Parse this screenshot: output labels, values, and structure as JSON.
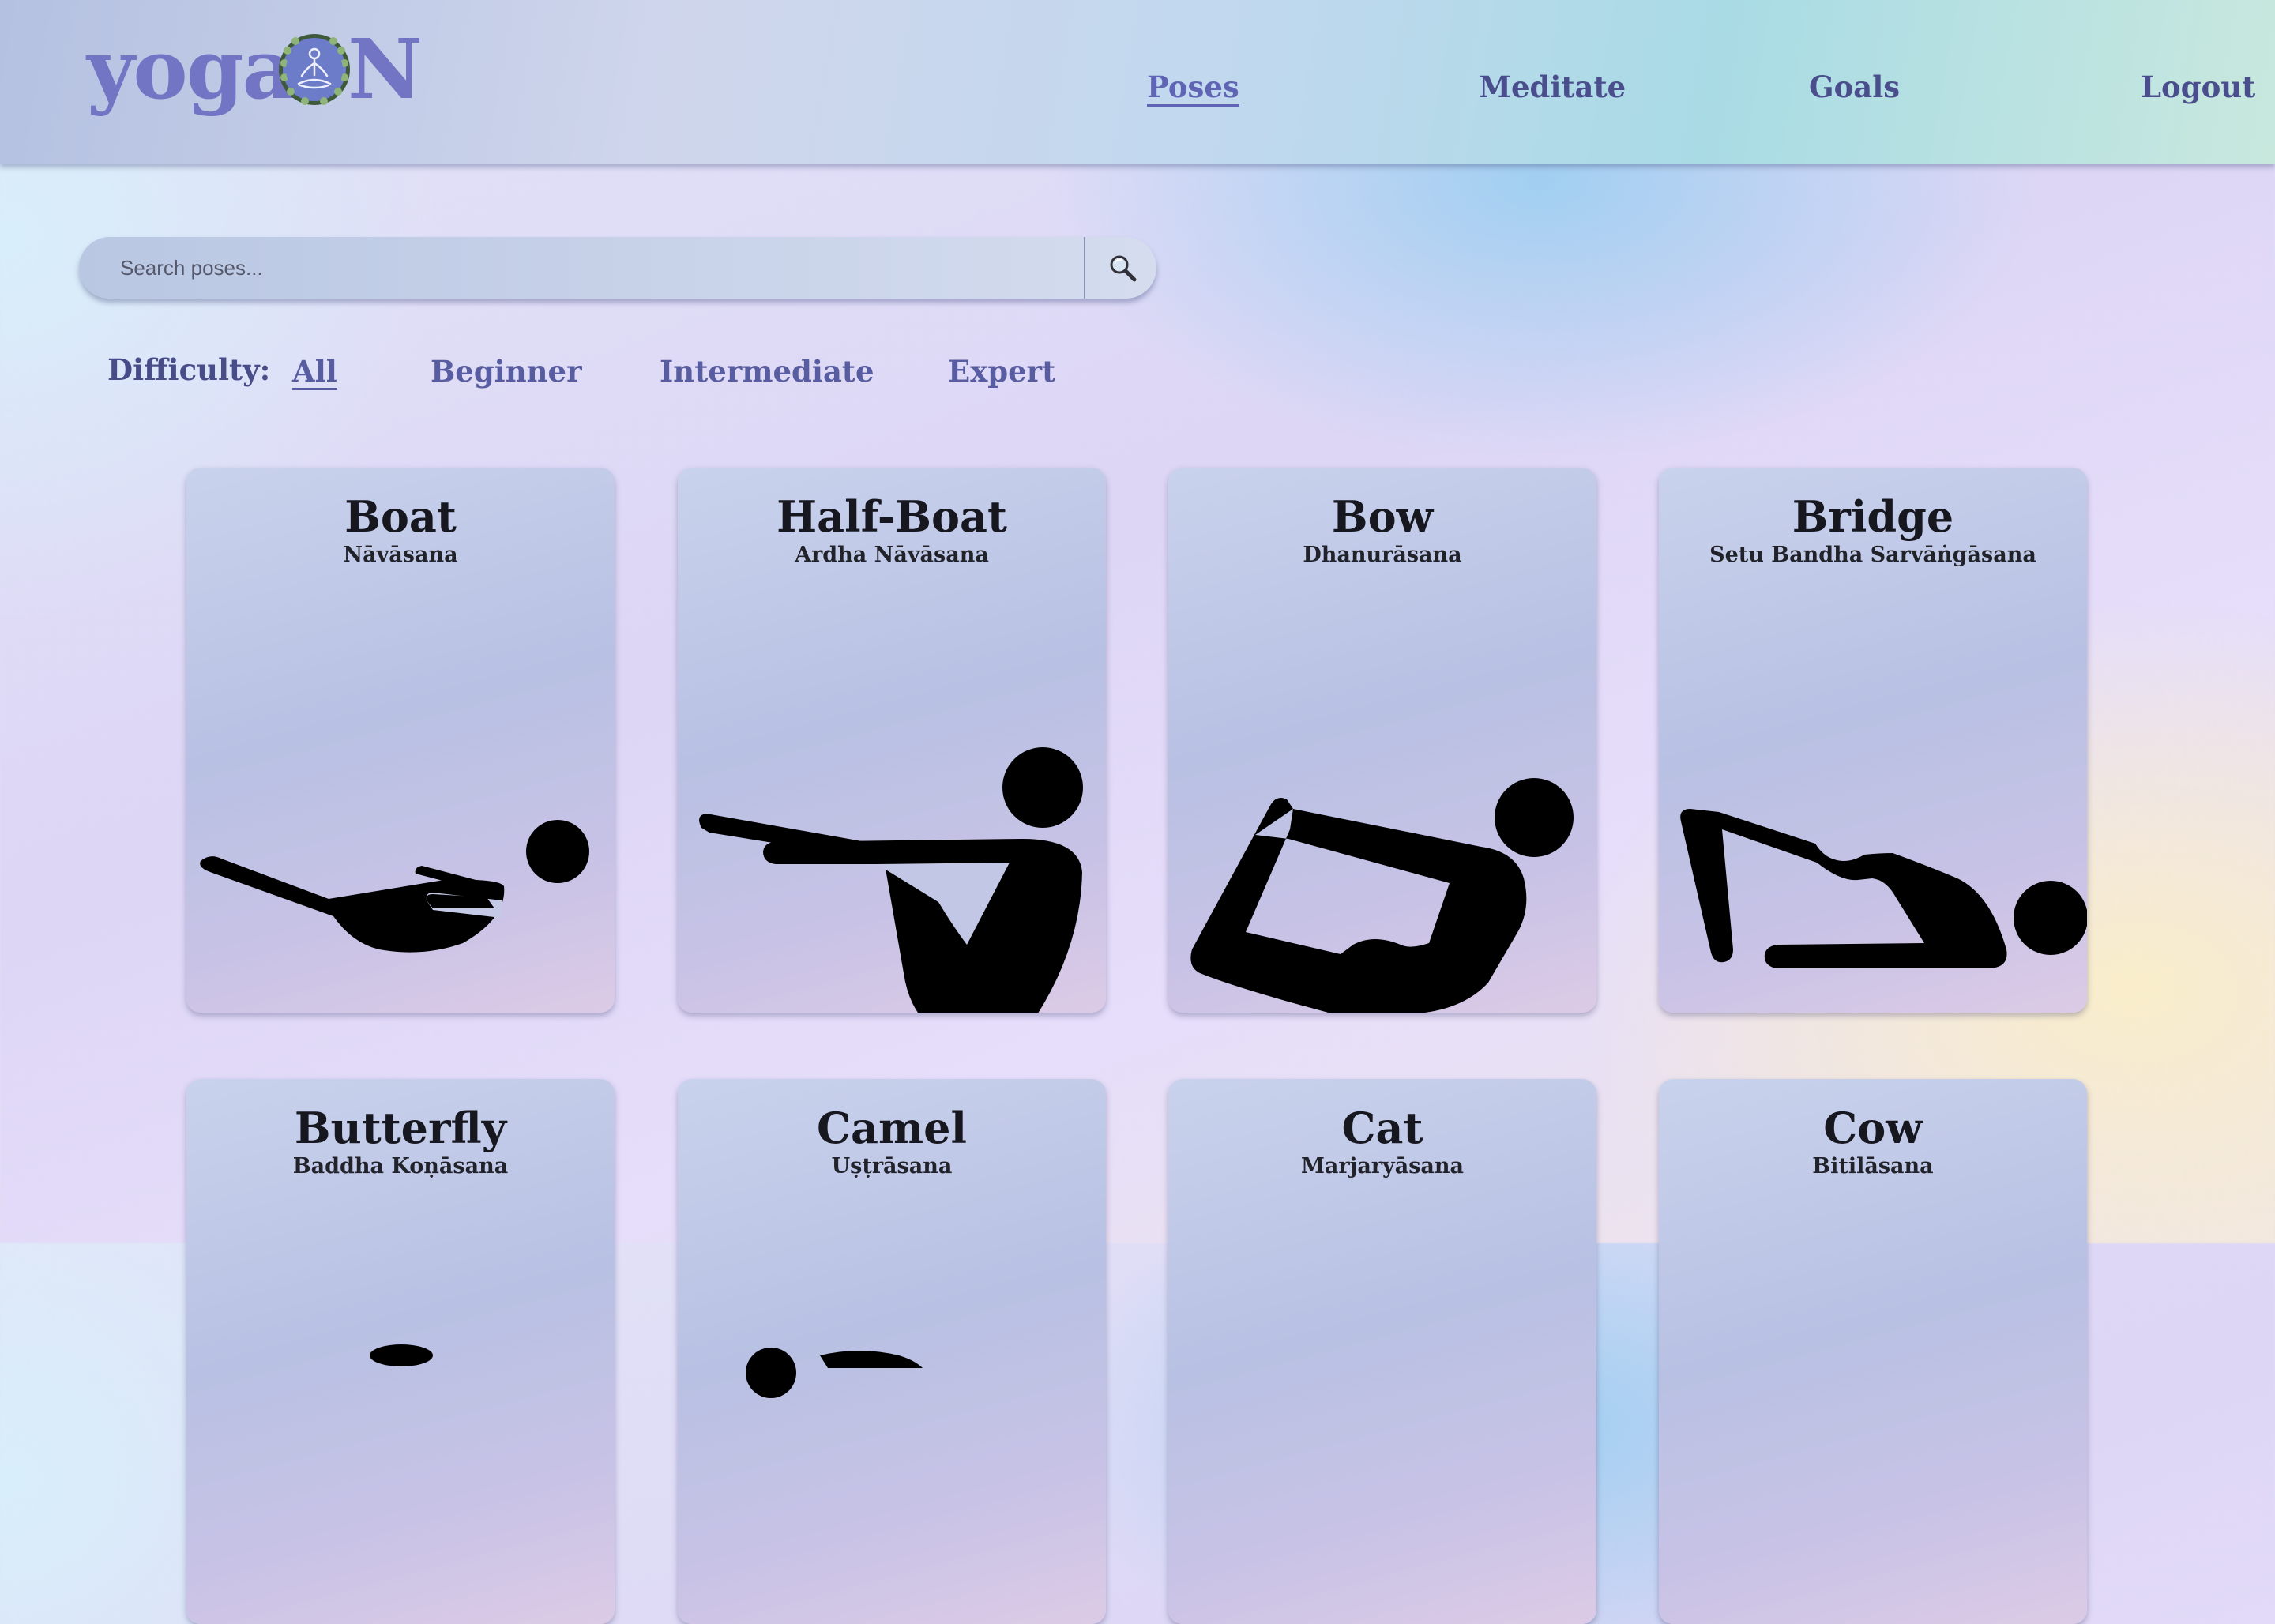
{
  "app": {
    "logo_left": "yoga",
    "logo_right": "N"
  },
  "nav": {
    "items": [
      {
        "label": "Poses",
        "active": true
      },
      {
        "label": "Meditate",
        "active": false
      },
      {
        "label": "Goals",
        "active": false
      },
      {
        "label": "Logout",
        "active": false
      }
    ]
  },
  "search": {
    "placeholder": "Search poses...",
    "value": "",
    "button_icon": "magnifier-icon"
  },
  "difficulty": {
    "label": "Difficulty:",
    "options": [
      {
        "label": "All",
        "active": true
      },
      {
        "label": "Beginner",
        "active": false
      },
      {
        "label": "Intermediate",
        "active": false
      },
      {
        "label": "Expert",
        "active": false
      }
    ]
  },
  "poses": [
    {
      "name": "Boat",
      "sanskrit": "Nāvāsana",
      "icon": "boat-pose-icon"
    },
    {
      "name": "Half-Boat",
      "sanskrit": "Ardha Nāvāsana",
      "icon": "half-boat-pose-icon"
    },
    {
      "name": "Bow",
      "sanskrit": "Dhanurāsana",
      "icon": "bow-pose-icon"
    },
    {
      "name": "Bridge",
      "sanskrit": "Setu Bandha Sarvāṅgāsana",
      "icon": "bridge-pose-icon"
    },
    {
      "name": "Butterfly",
      "sanskrit": "Baddha Koṇāsana",
      "icon": "butterfly-pose-icon"
    },
    {
      "name": "Camel",
      "sanskrit": "Uṣṭrāsana",
      "icon": "camel-pose-icon"
    },
    {
      "name": "Cat",
      "sanskrit": "Marjaryāsana",
      "icon": "cat-pose-icon"
    },
    {
      "name": "Cow",
      "sanskrit": "Bitilāsana",
      "icon": "cow-pose-icon"
    }
  ],
  "colors": {
    "accent": "#7274c4",
    "nav_text": "#4a4e8c",
    "card_title": "#17171f"
  }
}
